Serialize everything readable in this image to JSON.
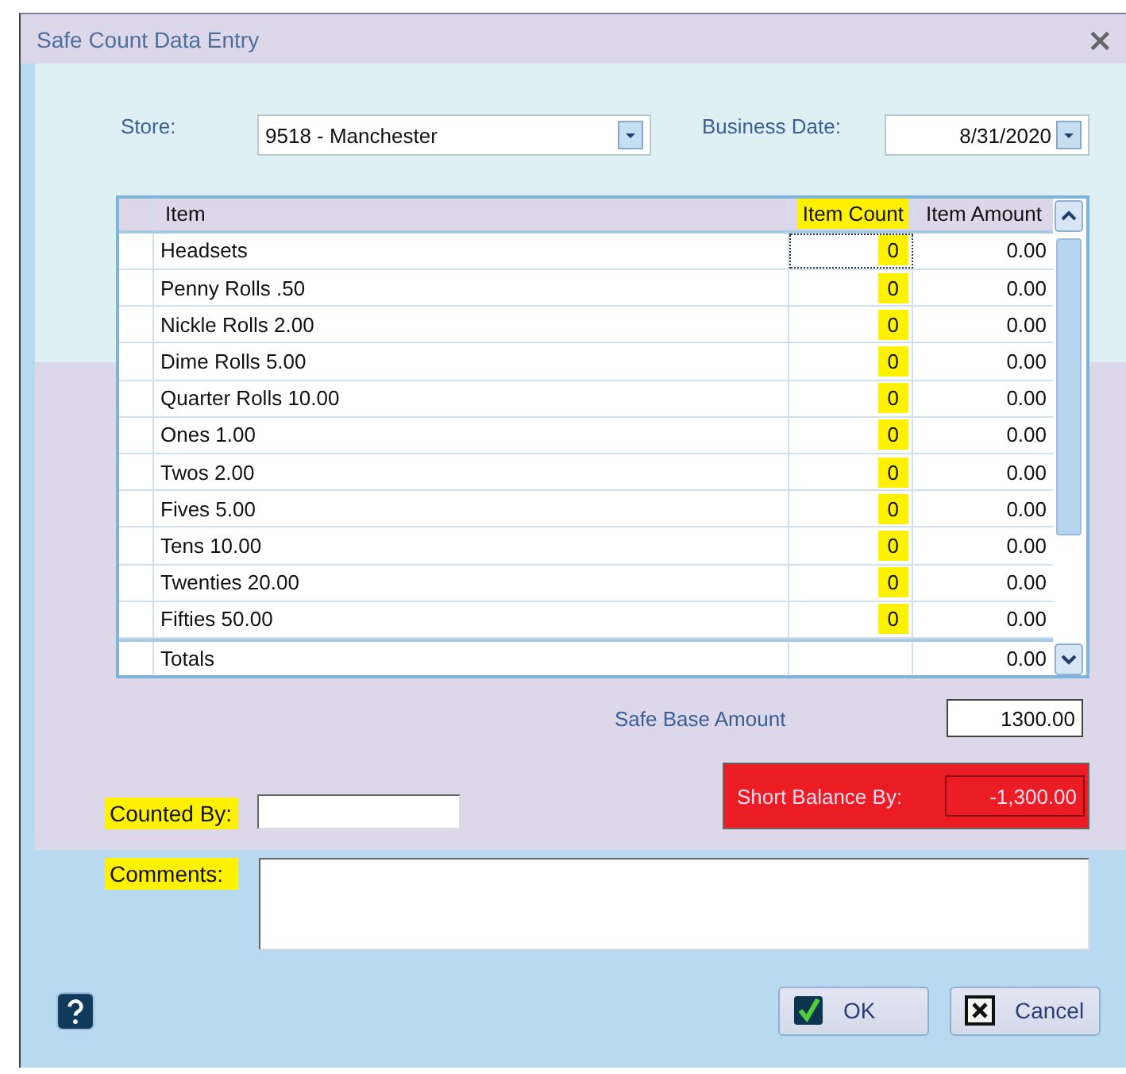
{
  "window": {
    "title": "Safe Count Data Entry",
    "close": "×"
  },
  "store": {
    "label": "Store:",
    "value": "9518 - Manchester"
  },
  "business_date": {
    "label": "Business Date:",
    "value": "8/31/2020"
  },
  "grid": {
    "columns": [
      {
        "label": "Item",
        "highlighted": false
      },
      {
        "label": "Item Count",
        "highlighted": true
      },
      {
        "label": "Item Amount",
        "highlighted": false
      }
    ],
    "count_highlighted": true,
    "rows": [
      {
        "item": "Headsets",
        "count": "0",
        "amount": "0.00",
        "focused": true
      },
      {
        "item": "Penny Rolls .50",
        "count": "0",
        "amount": "0.00",
        "focused": false
      },
      {
        "item": "Nickle Rolls 2.00",
        "count": "0",
        "amount": "0.00",
        "focused": false
      },
      {
        "item": "Dime Rolls 5.00",
        "count": "0",
        "amount": "0.00",
        "focused": false
      },
      {
        "item": "Quarter Rolls 10.00",
        "count": "0",
        "amount": "0.00",
        "focused": false
      },
      {
        "item": "Ones 1.00",
        "count": "0",
        "amount": "0.00",
        "focused": false
      },
      {
        "item": "Twos 2.00",
        "count": "0",
        "amount": "0.00",
        "focused": false
      },
      {
        "item": "Fives 5.00",
        "count": "0",
        "amount": "0.00",
        "focused": false
      },
      {
        "item": "Tens 10.00",
        "count": "0",
        "amount": "0.00",
        "focused": false
      },
      {
        "item": "Twenties 20.00",
        "count": "0",
        "amount": "0.00",
        "focused": false
      },
      {
        "item": "Fifties 50.00",
        "count": "0",
        "amount": "0.00",
        "focused": false
      }
    ],
    "totals": {
      "label": "Totals",
      "amount": "0.00"
    }
  },
  "safe_base": {
    "label": "Safe Base Amount",
    "value": "1300.00"
  },
  "short_balance": {
    "label": "Short Balance By:",
    "value": "-1,300.00"
  },
  "counted_by": {
    "label": "Counted By:",
    "highlighted": true
  },
  "comments": {
    "label": "Comments:",
    "highlighted": true
  },
  "buttons": [
    {
      "kind": "ok",
      "label": "OK"
    },
    {
      "kind": "cancel",
      "label": "Cancel"
    }
  ]
}
